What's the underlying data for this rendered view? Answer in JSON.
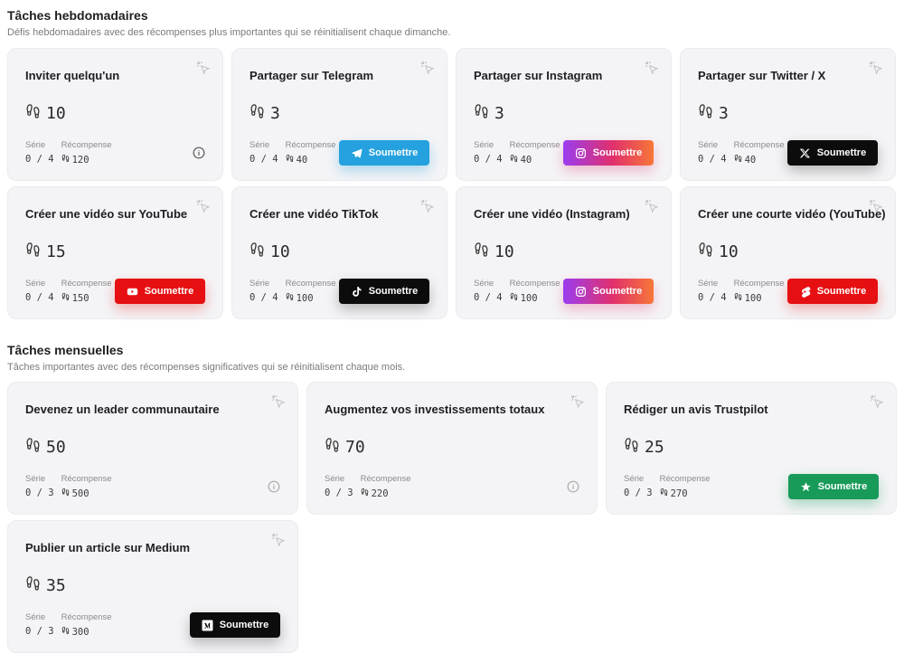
{
  "weekly": {
    "title": "Tâches hebdomadaires",
    "subtitle": "Défis hebdomadaires avec des récompenses plus importantes qui se réinitialisent chaque dimanche.",
    "cards": [
      {
        "title": "Inviter quelqu'un",
        "points": "10",
        "streak_label": "Série",
        "streak": "0 / 4",
        "reward_label": "Récompense",
        "reward": "120",
        "action": "info",
        "button_label": ""
      },
      {
        "title": "Partager sur Telegram",
        "points": "3",
        "streak_label": "Série",
        "streak": "0 / 4",
        "reward_label": "Récompense",
        "reward": "40",
        "action": "telegram",
        "button_label": "Soumettre"
      },
      {
        "title": "Partager sur Instagram",
        "points": "3",
        "streak_label": "Série",
        "streak": "0 / 4",
        "reward_label": "Récompense",
        "reward": "40",
        "action": "instagram",
        "button_label": "Soumettre"
      },
      {
        "title": "Partager sur Twitter / X",
        "points": "3",
        "streak_label": "Série",
        "streak": "0 / 4",
        "reward_label": "Récompense",
        "reward": "40",
        "action": "twitter",
        "button_label": "Soumettre"
      },
      {
        "title": "Créer une vidéo sur YouTube",
        "points": "15",
        "streak_label": "Série",
        "streak": "0 / 4",
        "reward_label": "Récompense",
        "reward": "150",
        "action": "youtube",
        "button_label": "Soumettre"
      },
      {
        "title": "Créer une vidéo TikTok",
        "points": "10",
        "streak_label": "Série",
        "streak": "0 / 4",
        "reward_label": "Récompense",
        "reward": "100",
        "action": "tiktok",
        "button_label": "Soumettre"
      },
      {
        "title": "Créer une vidéo (Instagram)",
        "points": "10",
        "streak_label": "Série",
        "streak": "0 / 4",
        "reward_label": "Récompense",
        "reward": "100",
        "action": "instagram",
        "button_label": "Soumettre"
      },
      {
        "title": "Créer une courte vidéo (YouTube)",
        "points": "10",
        "streak_label": "Série",
        "streak": "0 / 4",
        "reward_label": "Récompense",
        "reward": "100",
        "action": "youtube-shorts",
        "button_label": "Soumettre"
      }
    ]
  },
  "monthly": {
    "title": "Tâches mensuelles",
    "subtitle": "Tâches importantes avec des récompenses significatives qui se réinitialisent chaque mois.",
    "cards": [
      {
        "title": "Devenez un leader communautaire",
        "points": "50",
        "streak_label": "Série",
        "streak": "0 / 3",
        "reward_label": "Récompense",
        "reward": "500",
        "action": "info",
        "button_label": ""
      },
      {
        "title": "Augmentez vos investissements totaux",
        "points": "70",
        "streak_label": "Série",
        "streak": "0 / 3",
        "reward_label": "Récompense",
        "reward": "220",
        "action": "info",
        "button_label": ""
      },
      {
        "title": "Rédiger un avis Trustpilot",
        "points": "25",
        "streak_label": "Série",
        "streak": "0 / 3",
        "reward_label": "Récompense",
        "reward": "270",
        "action": "trustpilot",
        "button_label": "Soumettre"
      },
      {
        "title": "Publier un article sur Medium",
        "points": "35",
        "streak_label": "Série",
        "streak": "0 / 3",
        "reward_label": "Récompense",
        "reward": "300",
        "action": "medium",
        "button_label": "Soumettre"
      }
    ]
  },
  "colors": {
    "telegram": "#24a1de",
    "youtube": "#e60f12",
    "trustpilot": "#189a58",
    "dark": "#0c0c0c",
    "instagram_gradient": [
      "#9b3df0",
      "#e1306c",
      "#f77737"
    ],
    "card_bg": "#f4f4f6"
  }
}
